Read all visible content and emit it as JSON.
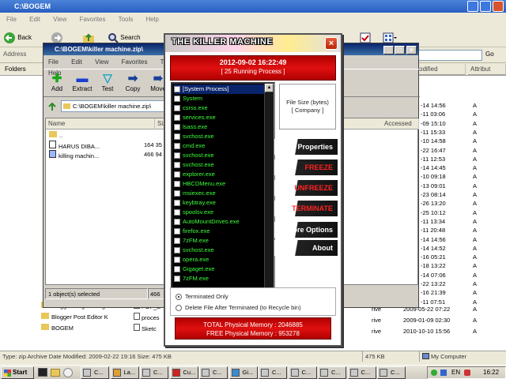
{
  "explorer": {
    "title": "C:\\BOGEM",
    "menu": [
      "File",
      "Edit",
      "View",
      "Favorites",
      "Tools",
      "Help"
    ],
    "back_label": "Back",
    "search_label": "Search",
    "address_label": "Address",
    "go_label": "Go",
    "folders_label": "Folders",
    "columns": {
      "modified": "odified",
      "attributes": "Attribut"
    },
    "rows": [
      {
        "date": "-14 14:56",
        "attr": "A"
      },
      {
        "date": "-11 03:06",
        "attr": "A"
      },
      {
        "date": "-09 15:10",
        "attr": "A"
      },
      {
        "date": "-11 15:33",
        "attr": "A"
      },
      {
        "date": "-10 14:58",
        "attr": "A"
      },
      {
        "date": "-22 16:47",
        "attr": "A"
      },
      {
        "date": "-11 12:53",
        "attr": "A"
      },
      {
        "date": "-14 14:45",
        "attr": "A"
      },
      {
        "date": "-10 09:18",
        "attr": "A"
      },
      {
        "date": "-13 09:01",
        "attr": "A"
      },
      {
        "date": "-23 08:14",
        "attr": "A"
      },
      {
        "date": "-26 13:20",
        "attr": "A"
      },
      {
        "date": "-25 10:12",
        "attr": "A"
      },
      {
        "date": "-11 13:34",
        "attr": "A"
      },
      {
        "date": "-11 20:48",
        "attr": "A"
      },
      {
        "date": "-14 14:56",
        "attr": "A"
      },
      {
        "date": "-14 14:52",
        "attr": "A"
      },
      {
        "date": "-16 05:21",
        "attr": "A"
      },
      {
        "date": "-18 13:22",
        "attr": "A"
      },
      {
        "date": "-14 07:06",
        "attr": "A"
      },
      {
        "date": "-22 13:22",
        "attr": "A"
      },
      {
        "date": "-16 21:39",
        "attr": "A"
      },
      {
        "date": "-11 07:51",
        "attr": "A"
      }
    ],
    "bottom_rows": [
      {
        "type": "rive",
        "date": "2009-05-22 07:22",
        "attr": "A"
      },
      {
        "type": "rive",
        "date": "2009-01-09 02:30",
        "attr": "A"
      },
      {
        "type": "rive",
        "date": "2010-10-10 15:56",
        "attr": "A"
      }
    ],
    "left_folders": [
      "Blogger Original Juga Bi",
      "Blogger Post Editor K",
      "BOGEM"
    ],
    "mid_files": [
      "PDF_E",
      "proces",
      "Sketc"
    ],
    "status_text": "Type: zip Archive Date Modified: 2009-02-22 19:16 Size: 475 KB",
    "status_size": "475 KB",
    "status_location": "My Computer"
  },
  "zip": {
    "title": "C:\\BOGEM\\killer machine.zip\\",
    "menu": [
      "File",
      "Edit",
      "View",
      "Favorites",
      "Tools",
      "Help"
    ],
    "commands": [
      "Add",
      "Extract",
      "Test",
      "Copy",
      "Move"
    ],
    "path": "C:\\BOGEM\\killer machine.zip\\",
    "col_name": "Name",
    "col_size": "Siz",
    "col_accessed": "Accessed",
    "files": [
      {
        "name": "..",
        "size": ""
      },
      {
        "name": "HARUS DIBA...",
        "size": "164 35"
      },
      {
        "name": "killing machin...",
        "size": "466 94"
      }
    ],
    "status_left": "1 object(s) selected",
    "status_mid": "466 94"
  },
  "killer": {
    "title": "THE KILLER MACHINE",
    "datetime": "2012-09-02 16:22:49",
    "running": "[ 25 Running Process ]",
    "processes": [
      "[System Process]",
      "System",
      "csrss.exe",
      "services.exe",
      "lsass.exe",
      "svchost.exe",
      "cmd.exe",
      "svchost.exe",
      "svchost.exe",
      "explorer.exe",
      "HBCDMenu.exe",
      "msiexec.exe",
      "keybtray.exe",
      "spoolsv.exe",
      "AutoMountDrives.exe",
      "firefox.exe",
      "7zFM.exe",
      "svchost.exe",
      "opera.exe",
      "Gigaget.exe",
      "7zFM.exe"
    ],
    "info_line1": "File Size (bytes)",
    "info_line2": "[ Company ]",
    "buttons": {
      "properties": "Properties",
      "freeze": "FREEZE",
      "unfreeze": "UNFREEZE",
      "terminate": "TERMINATE",
      "more": "More Options",
      "about": "About"
    },
    "option_terminated_only": "Terminated Only",
    "option_delete": "Delete File After Terminated  (to Recycle bin)",
    "mem_total": "TOTAL Physical Memory : 2046885",
    "mem_free": "FREE Physical Memory : 953278"
  },
  "taskbar": {
    "start": "Start",
    "tasks": [
      "C...",
      "La...",
      "C...",
      "Cu...",
      "C...",
      "Gi...",
      "C...",
      "C...",
      "C...",
      "C...",
      "C..."
    ],
    "tray_lang": "EN",
    "clock": "16:22"
  },
  "colors": {
    "process_text": "#3cff3c",
    "header_red": "#d01010",
    "danger_text": "#ff2222"
  }
}
